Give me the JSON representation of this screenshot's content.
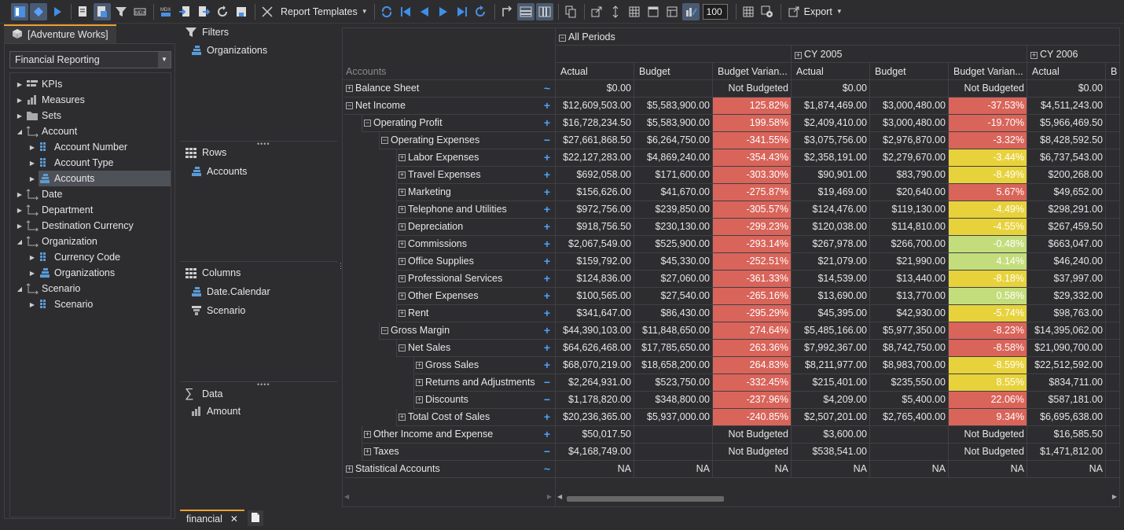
{
  "toolbar": {
    "report_templates_label": "Report Templates",
    "zoom_value": "100",
    "export_label": "Export",
    "icons": [
      "field-list-icon",
      "pivot-icon",
      "play-icon",
      "report-icon",
      "grid-layout-icon",
      "filter-icon",
      "mdx-icon",
      "mdx-edit-icon",
      "import-icon",
      "export-icon",
      "refresh-icon",
      "save-icon",
      "templates-icon",
      "sync-icon",
      "first-icon",
      "prev-icon",
      "next-icon",
      "last-icon",
      "redo-icon",
      "swap-icon",
      "rows-layout-icon",
      "cols-layout-icon",
      "copy-icon",
      "popout-icon",
      "expand-icon",
      "grid-icon",
      "table-icon",
      "bar-chart-icon",
      "chart-edit-icon",
      "cells-icon",
      "settings-icon"
    ]
  },
  "left": {
    "tab_label": "[Adventure Works]",
    "perspective": "Financial Reporting",
    "tree": [
      {
        "label": "KPIs",
        "level": 0,
        "exp": "closed",
        "icon": "kpi"
      },
      {
        "label": "Measures",
        "level": 0,
        "exp": "closed",
        "icon": "measure"
      },
      {
        "label": "Sets",
        "level": 0,
        "exp": "closed",
        "icon": "folder"
      },
      {
        "label": "Account",
        "level": 0,
        "exp": "open",
        "icon": "dim"
      },
      {
        "label": "Account Number",
        "level": 1,
        "exp": "closed",
        "icon": "attr"
      },
      {
        "label": "Account Type",
        "level": 1,
        "exp": "closed",
        "icon": "attr"
      },
      {
        "label": "Accounts",
        "level": 1,
        "exp": "closed",
        "icon": "hier",
        "selected": true
      },
      {
        "label": "Date",
        "level": 0,
        "exp": "closed",
        "icon": "dim"
      },
      {
        "label": "Department",
        "level": 0,
        "exp": "closed",
        "icon": "dim"
      },
      {
        "label": "Destination Currency",
        "level": 0,
        "exp": "closed",
        "icon": "dim"
      },
      {
        "label": "Organization",
        "level": 0,
        "exp": "open",
        "icon": "dim"
      },
      {
        "label": "Currency Code",
        "level": 1,
        "exp": "closed",
        "icon": "attr"
      },
      {
        "label": "Organizations",
        "level": 1,
        "exp": "closed",
        "icon": "hier"
      },
      {
        "label": "Scenario",
        "level": 0,
        "exp": "open",
        "icon": "dim"
      },
      {
        "label": "Scenario",
        "level": 1,
        "exp": "closed",
        "icon": "attr"
      }
    ]
  },
  "middle": {
    "filters_title": "Filters",
    "filters": [
      "Organizations"
    ],
    "rows_title": "Rows",
    "rows": [
      "Accounts"
    ],
    "columns_title": "Columns",
    "columns": [
      "Date.Calendar",
      "Scenario"
    ],
    "data_title": "Data",
    "data": [
      "Amount"
    ]
  },
  "grid": {
    "all_periods": "All Periods",
    "accounts_header": "Accounts",
    "years": [
      "CY 2005",
      "CY 2006"
    ],
    "measures": [
      "Actual",
      "Budget",
      "Budget Varian...",
      "Actual",
      "Budget",
      "Budget Varian...",
      "Actual",
      "B"
    ],
    "rows": [
      {
        "label": "Balance Sheet",
        "level": 0,
        "exp": "+",
        "sym": "~",
        "cells": [
          "$0.00",
          "",
          "Not Budgeted",
          "$0.00",
          "",
          "Not Budgeted",
          "$0.00",
          ""
        ],
        "c": [
          "",
          "",
          "",
          "",
          "",
          "",
          "",
          ""
        ]
      },
      {
        "label": "Net Income",
        "level": 0,
        "exp": "-",
        "sym": "+",
        "cells": [
          "$12,609,503.00",
          "$5,583,900.00",
          "125.82%",
          "$1,874,469.00",
          "$3,000,480.00",
          "-37.53%",
          "$4,511,243.00",
          ""
        ],
        "c": [
          "",
          "",
          "r",
          "",
          "",
          "r",
          "",
          ""
        ]
      },
      {
        "label": "Operating Profit",
        "level": 1,
        "exp": "-",
        "sym": "+",
        "cells": [
          "$16,728,234.50",
          "$5,583,900.00",
          "199.58%",
          "$2,409,410.00",
          "$3,000,480.00",
          "-19.70%",
          "$5,966,469.50",
          ""
        ],
        "c": [
          "",
          "",
          "r",
          "",
          "",
          "r",
          "",
          ""
        ]
      },
      {
        "label": "Operating Expenses",
        "level": 2,
        "exp": "-",
        "sym": "−",
        "cells": [
          "$27,661,868.50",
          "$6,264,750.00",
          "-341.55%",
          "$3,075,756.00",
          "$2,976,870.00",
          "-3.32%",
          "$8,428,592.50",
          ""
        ],
        "c": [
          "",
          "",
          "r",
          "",
          "",
          "r",
          "",
          ""
        ]
      },
      {
        "label": "Labor Expenses",
        "level": 3,
        "exp": "+",
        "sym": "+",
        "cells": [
          "$22,127,283.00",
          "$4,869,240.00",
          "-354.43%",
          "$2,358,191.00",
          "$2,279,670.00",
          "-3.44%",
          "$6,737,543.00",
          ""
        ],
        "c": [
          "",
          "",
          "r",
          "",
          "",
          "y",
          "",
          ""
        ]
      },
      {
        "label": "Travel Expenses",
        "level": 3,
        "exp": "+",
        "sym": "+",
        "cells": [
          "$692,058.00",
          "$171,600.00",
          "-303.30%",
          "$90,901.00",
          "$83,790.00",
          "-8.49%",
          "$200,268.00",
          ""
        ],
        "c": [
          "",
          "",
          "r",
          "",
          "",
          "y",
          "",
          ""
        ]
      },
      {
        "label": "Marketing",
        "level": 3,
        "exp": "+",
        "sym": "+",
        "cells": [
          "$156,626.00",
          "$41,670.00",
          "-275.87%",
          "$19,469.00",
          "$20,640.00",
          "5.67%",
          "$49,652.00",
          ""
        ],
        "c": [
          "",
          "",
          "r",
          "",
          "",
          "r",
          "",
          ""
        ]
      },
      {
        "label": "Telephone and Utilities",
        "level": 3,
        "exp": "+",
        "sym": "+",
        "cells": [
          "$972,756.00",
          "$239,850.00",
          "-305.57%",
          "$124,476.00",
          "$119,130.00",
          "-4.49%",
          "$298,291.00",
          ""
        ],
        "c": [
          "",
          "",
          "r",
          "",
          "",
          "y",
          "",
          ""
        ]
      },
      {
        "label": "Depreciation",
        "level": 3,
        "exp": "+",
        "sym": "+",
        "cells": [
          "$918,756.50",
          "$230,130.00",
          "-299.23%",
          "$120,038.00",
          "$114,810.00",
          "-4.55%",
          "$267,459.50",
          ""
        ],
        "c": [
          "",
          "",
          "r",
          "",
          "",
          "y",
          "",
          ""
        ]
      },
      {
        "label": "Commissions",
        "level": 3,
        "exp": "+",
        "sym": "+",
        "cells": [
          "$2,067,549.00",
          "$525,900.00",
          "-293.14%",
          "$267,978.00",
          "$266,700.00",
          "-0.48%",
          "$663,047.00",
          ""
        ],
        "c": [
          "",
          "",
          "r",
          "",
          "",
          "g",
          "",
          ""
        ]
      },
      {
        "label": "Office Supplies",
        "level": 3,
        "exp": "+",
        "sym": "+",
        "cells": [
          "$159,792.00",
          "$45,330.00",
          "-252.51%",
          "$21,079.00",
          "$21,990.00",
          "4.14%",
          "$46,240.00",
          ""
        ],
        "c": [
          "",
          "",
          "r",
          "",
          "",
          "g",
          "",
          ""
        ]
      },
      {
        "label": "Professional Services",
        "level": 3,
        "exp": "+",
        "sym": "+",
        "cells": [
          "$124,836.00",
          "$27,060.00",
          "-361.33%",
          "$14,539.00",
          "$13,440.00",
          "-8.18%",
          "$37,997.00",
          ""
        ],
        "c": [
          "",
          "",
          "r",
          "",
          "",
          "y",
          "",
          ""
        ]
      },
      {
        "label": "Other Expenses",
        "level": 3,
        "exp": "+",
        "sym": "+",
        "cells": [
          "$100,565.00",
          "$27,540.00",
          "-265.16%",
          "$13,690.00",
          "$13,770.00",
          "0.58%",
          "$29,332.00",
          ""
        ],
        "c": [
          "",
          "",
          "r",
          "",
          "",
          "g",
          "",
          ""
        ]
      },
      {
        "label": "Rent",
        "level": 3,
        "exp": "+",
        "sym": "+",
        "cells": [
          "$341,647.00",
          "$86,430.00",
          "-295.29%",
          "$45,395.00",
          "$42,930.00",
          "-5.74%",
          "$98,763.00",
          ""
        ],
        "c": [
          "",
          "",
          "r",
          "",
          "",
          "y",
          "",
          ""
        ]
      },
      {
        "label": "Gross Margin",
        "level": 2,
        "exp": "-",
        "sym": "+",
        "cells": [
          "$44,390,103.00",
          "$11,848,650.00",
          "274.64%",
          "$5,485,166.00",
          "$5,977,350.00",
          "-8.23%",
          "$14,395,062.00",
          ""
        ],
        "c": [
          "",
          "",
          "r",
          "",
          "",
          "r",
          "",
          ""
        ]
      },
      {
        "label": "Net Sales",
        "level": 3,
        "exp": "-",
        "sym": "+",
        "cells": [
          "$64,626,468.00",
          "$17,785,650.00",
          "263.36%",
          "$7,992,367.00",
          "$8,742,750.00",
          "-8.58%",
          "$21,090,700.00",
          ""
        ],
        "c": [
          "",
          "",
          "r",
          "",
          "",
          "r",
          "",
          ""
        ]
      },
      {
        "label": "Gross Sales",
        "level": 4,
        "exp": "+",
        "sym": "+",
        "cells": [
          "$68,070,219.00",
          "$18,658,200.00",
          "264.83%",
          "$8,211,977.00",
          "$8,983,700.00",
          "-8.59%",
          "$22,512,592.00",
          ""
        ],
        "c": [
          "",
          "",
          "r",
          "",
          "",
          "y",
          "",
          ""
        ]
      },
      {
        "label": "Returns and Adjustments",
        "level": 4,
        "exp": "+",
        "sym": "−",
        "cells": [
          "$2,264,931.00",
          "$523,750.00",
          "-332.45%",
          "$215,401.00",
          "$235,550.00",
          "8.55%",
          "$834,711.00",
          ""
        ],
        "c": [
          "",
          "",
          "r",
          "",
          "",
          "y",
          "",
          ""
        ]
      },
      {
        "label": "Discounts",
        "level": 4,
        "exp": "+",
        "sym": "−",
        "cells": [
          "$1,178,820.00",
          "$348,800.00",
          "-237.96%",
          "$4,209.00",
          "$5,400.00",
          "22.06%",
          "$587,181.00",
          ""
        ],
        "c": [
          "",
          "",
          "r",
          "",
          "",
          "r",
          "",
          ""
        ]
      },
      {
        "label": "Total Cost of Sales",
        "level": 3,
        "exp": "+",
        "sym": "+",
        "cells": [
          "$20,236,365.00",
          "$5,937,000.00",
          "-240.85%",
          "$2,507,201.00",
          "$2,765,400.00",
          "9.34%",
          "$6,695,638.00",
          ""
        ],
        "c": [
          "",
          "",
          "r",
          "",
          "",
          "r",
          "",
          ""
        ]
      },
      {
        "label": "Other Income and Expense",
        "level": 1,
        "exp": "+",
        "sym": "+",
        "cells": [
          "$50,017.50",
          "",
          "Not Budgeted",
          "$3,600.00",
          "",
          "Not Budgeted",
          "$16,585.50",
          ""
        ],
        "c": [
          "",
          "",
          "",
          "",
          "",
          "",
          "",
          ""
        ]
      },
      {
        "label": "Taxes",
        "level": 1,
        "exp": "+",
        "sym": "−",
        "cells": [
          "$4,168,749.00",
          "",
          "Not Budgeted",
          "$538,541.00",
          "",
          "Not Budgeted",
          "$1,471,812.00",
          ""
        ],
        "c": [
          "",
          "",
          "",
          "",
          "",
          "",
          "",
          ""
        ]
      },
      {
        "label": "Statistical Accounts",
        "level": 0,
        "exp": "+",
        "sym": "~",
        "cells": [
          "NA",
          "NA",
          "NA",
          "NA",
          "NA",
          "NA",
          "NA",
          ""
        ],
        "c": [
          "",
          "",
          "",
          "",
          "",
          "",
          "",
          ""
        ]
      }
    ]
  },
  "bottom": {
    "tab_label": "financial"
  },
  "colors": {
    "red": "#d9645a",
    "yellow": "#e8d23c",
    "green": "#c4dd7c",
    "accent": "#f0a030",
    "blue": "#4aa3ff"
  }
}
